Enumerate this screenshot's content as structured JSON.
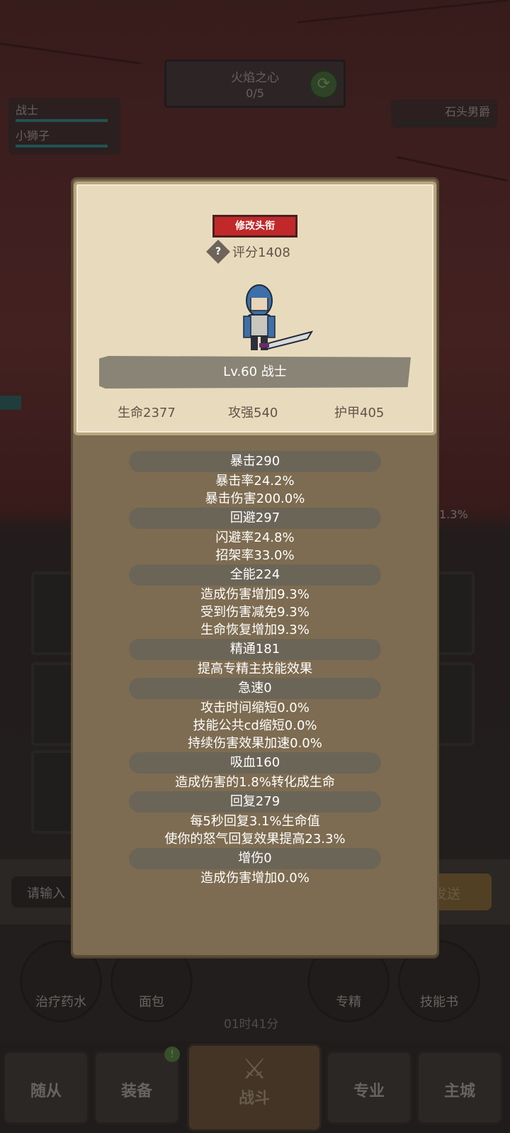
{
  "quest": {
    "title": "火焰之心",
    "progress": "0/5"
  },
  "party": {
    "members": [
      "战士",
      "小狮子"
    ]
  },
  "enemy": {
    "name": "石头男爵"
  },
  "background": {
    "side_pct": "1.3%",
    "chat_placeholder": "请输入",
    "send_label": "发送",
    "timer": "01时41分"
  },
  "items": [
    {
      "label": "治疗药水",
      "icon": "potion-icon"
    },
    {
      "label": "面包",
      "icon": "bread-icon"
    },
    {
      "label": "专精",
      "icon": "specialization-icon"
    },
    {
      "label": "技能书",
      "icon": "skill-book-icon"
    }
  ],
  "nav": {
    "followers": "随从",
    "equipment": "装备",
    "battle": "战斗",
    "profession": "专业",
    "city": "主城",
    "badge": "!"
  },
  "panel": {
    "rename_button": "修改头衔",
    "score": "评分1408",
    "level_class": "Lv.60 战士",
    "hp": "生命2377",
    "attack": "攻强540",
    "armor": "护甲405"
  },
  "attributes": [
    {
      "head": "暴击290",
      "lines": [
        "暴击率24.2%",
        "暴击伤害200.0%"
      ]
    },
    {
      "head": "回避297",
      "lines": [
        "闪避率24.8%",
        "招架率33.0%"
      ]
    },
    {
      "head": "全能224",
      "lines": [
        "造成伤害增加9.3%",
        "受到伤害减免9.3%",
        "生命恢复增加9.3%"
      ]
    },
    {
      "head": "精通181",
      "lines": [
        "提高专精主技能效果"
      ]
    },
    {
      "head": "急速0",
      "lines": [
        "攻击时间缩短0.0%",
        "技能公共cd缩短0.0%",
        "持续伤害效果加速0.0%"
      ]
    },
    {
      "head": "吸血160",
      "lines": [
        "造成伤害的1.8%转化成生命"
      ]
    },
    {
      "head": "回复279",
      "lines": [
        "每5秒回复3.1%生命值",
        "使你的怒气回复效果提高23.3%"
      ]
    },
    {
      "head": "增伤0",
      "lines": [
        "造成伤害增加0.0%"
      ]
    }
  ],
  "colors": {
    "panel": "#7d6c51",
    "parchment": "#e8dbbd",
    "title_btn": "#c0282a",
    "pill": "#6b6558"
  }
}
